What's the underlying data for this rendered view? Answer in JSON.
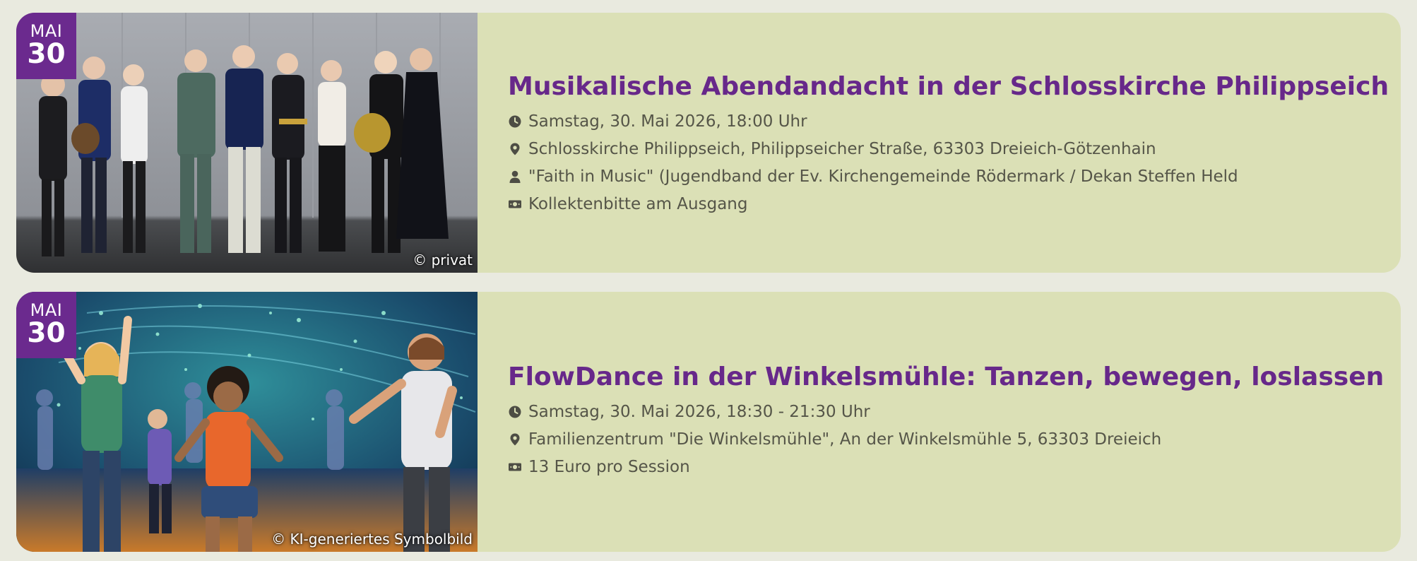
{
  "events": [
    {
      "date_month": "MAI",
      "date_day": "30",
      "image_credit": "© privat",
      "image_subject": "band-photo",
      "title": "Musikalische Abendandacht in der Schlosskirche Philippseich",
      "datetime": "Samstag, 30. Mai 2026, 18:00 Uhr",
      "location": "Schlosskirche Philippseich, Philippseicher Straße, 63303 Dreieich-Götzenhain",
      "performer": "\"Faith in Music\" (Jugendband der Ev. Kirchengemeinde Rödermark / Dekan Steffen Held",
      "price": "Kollektenbitte am Ausgang",
      "icons": [
        "clock-icon",
        "map-pin-icon",
        "person-icon",
        "cash-icon"
      ]
    },
    {
      "date_month": "MAI",
      "date_day": "30",
      "image_credit": "© KI-generiertes Symbolbild",
      "image_subject": "dance-illustration",
      "title": "FlowDance in der Winkelsmühle: Tanzen, bewegen, loslassen",
      "datetime": "Samstag, 30. Mai 2026, 18:30 - 21:30 Uhr",
      "location": "Familienzentrum \"Die Winkelsmühle\", An der Winkelsmühle 5, 63303 Dreieich",
      "price": "13 Euro pro Session",
      "icons": [
        "clock-icon",
        "map-pin-icon",
        "cash-icon"
      ]
    }
  ],
  "colors": {
    "page_background": "#e9eadf",
    "card_background": "#dbe0b6",
    "accent_purple": "#6b2a8e",
    "title_color": "#67288a",
    "text_color": "#555548"
  }
}
